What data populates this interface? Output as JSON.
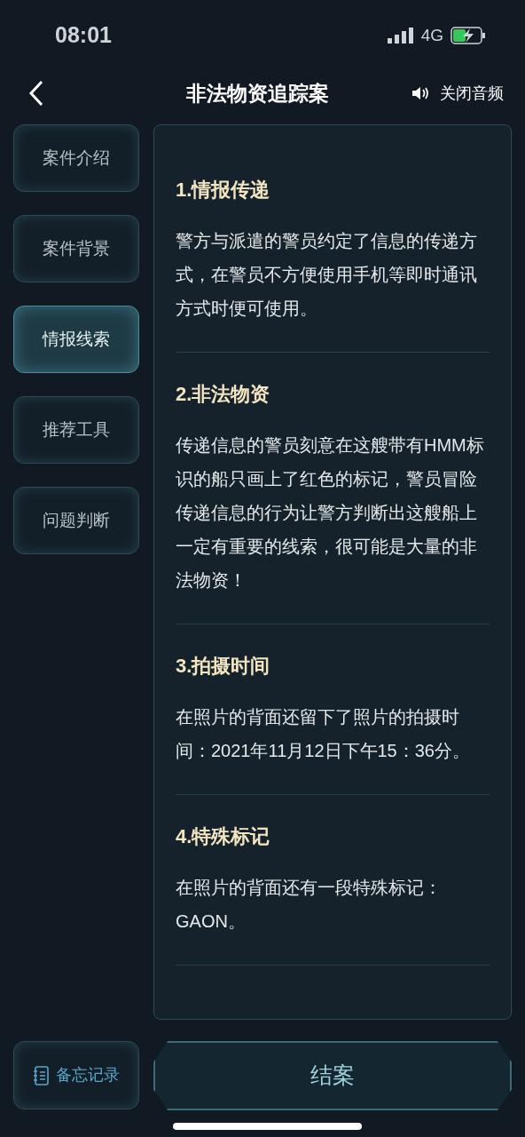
{
  "status_bar": {
    "time": "08:01",
    "network": "4G"
  },
  "header": {
    "title": "非法物资追踪案",
    "audio_button": "关闭音频"
  },
  "sidebar": {
    "items": [
      {
        "label": "案件介绍",
        "selected": false
      },
      {
        "label": "案件背景",
        "selected": false
      },
      {
        "label": "情报线索",
        "selected": true
      },
      {
        "label": "推荐工具",
        "selected": false
      },
      {
        "label": "问题判断",
        "selected": false
      }
    ]
  },
  "clues": [
    {
      "heading": "1.情报传递",
      "text": "警方与派遣的警员约定了信息的传递方式，在警员不方便使用手机等即时通讯方式时便可使用。"
    },
    {
      "heading": "2.非法物资",
      "text": "传递信息的警员刻意在这艘带有HMM标识的船只画上了红色的标记，警员冒险传递信息的行为让警方判断出这艘船上一定有重要的线索，很可能是大量的非法物资！"
    },
    {
      "heading": "3.拍摄时间",
      "text": "在照片的背面还留下了照片的拍摄时间：2021年11月12日下午15：36分。"
    },
    {
      "heading": "4.特殊标记",
      "text": "在照片的背面还有一段特殊标记：GAON。"
    }
  ],
  "footer": {
    "memo_button": "备忘记录",
    "close_case_button": "结案"
  }
}
